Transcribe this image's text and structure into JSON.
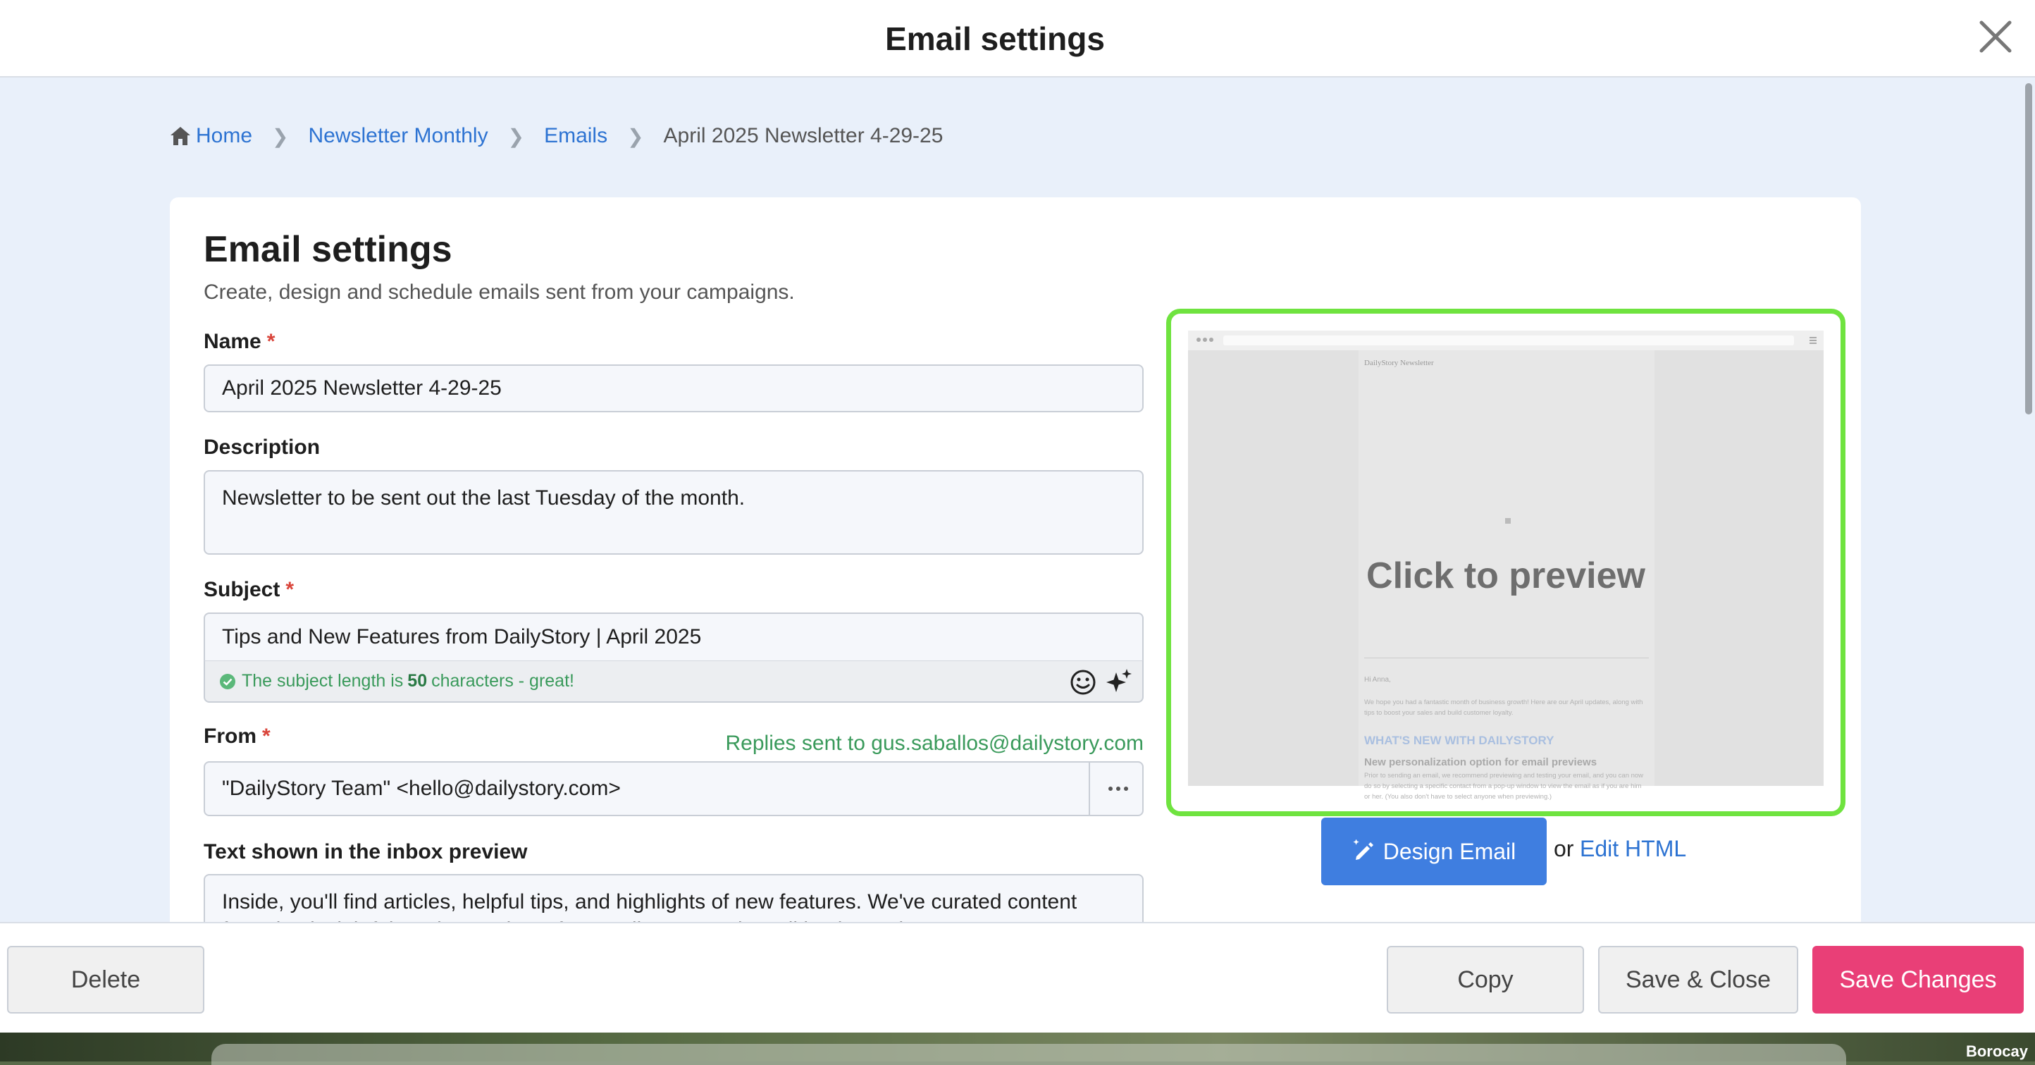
{
  "modal": {
    "title": "Email settings"
  },
  "breadcrumb": {
    "home": "Home",
    "items": [
      "Newsletter Monthly",
      "Emails"
    ],
    "current": "April 2025 Newsletter 4-29-25"
  },
  "card": {
    "title": "Email settings",
    "subtitle": "Create, design and schedule emails sent from your campaigns."
  },
  "form": {
    "name": {
      "label": "Name",
      "required": "*",
      "value": "April 2025 Newsletter 4-29-25"
    },
    "description": {
      "label": "Description",
      "value": "Newsletter to be sent out the last Tuesday of the month."
    },
    "subject": {
      "label": "Subject",
      "required": "*",
      "value": "Tips and New Features from DailyStory | April 2025",
      "status_prefix": "The subject length is",
      "status_count": "50",
      "status_suffix": "characters - great!"
    },
    "from": {
      "label": "From",
      "required": "*",
      "replies": "Replies sent to gus.saballos@dailystory.com",
      "value": "\"DailyStory Team\" <hello@dailystory.com>"
    },
    "preview_text": {
      "label": "Text shown in the inbox preview",
      "value": "Inside, you'll find articles, helpful tips, and highlights of new features. We've curated content featuring insightful product updates from DailyStory and small business tips."
    }
  },
  "preview": {
    "overlay": "Click to preview",
    "brand": "DailyStory Newsletter",
    "greeting": "Hi Anna,",
    "intro": "We hope you had a fantastic month of business growth! Here are our April updates, along with tips to boost your sales and build customer loyalty.",
    "section_heading": "WHAT'S NEW WITH DAILYSTORY",
    "article_title": "New personalization option for email previews",
    "article_body": "Prior to sending an email, we recommend previewing and testing your email, and you can now do so by selecting a specific contact from a pop-up window to view the email as if you are him or her. (You also don't have to select anyone when previewing.)"
  },
  "actions": {
    "design_email": "Design Email",
    "or": "or",
    "edit_html": "Edit HTML"
  },
  "footer": {
    "delete": "Delete",
    "copy": "Copy",
    "save_close": "Save & Close",
    "save_changes": "Save Changes"
  },
  "desktop": {
    "label": "Borocay"
  },
  "colors": {
    "accent": "#3f7ee0",
    "primary": "#e93f77",
    "preview_border": "#6fe33f",
    "success": "#3a9a5b"
  },
  "icons": [
    "close-icon",
    "home-icon",
    "chevron-right-icon",
    "check-circle-icon",
    "emoji-icon",
    "sparkle-icon",
    "more-icon",
    "pencil-icon"
  ]
}
